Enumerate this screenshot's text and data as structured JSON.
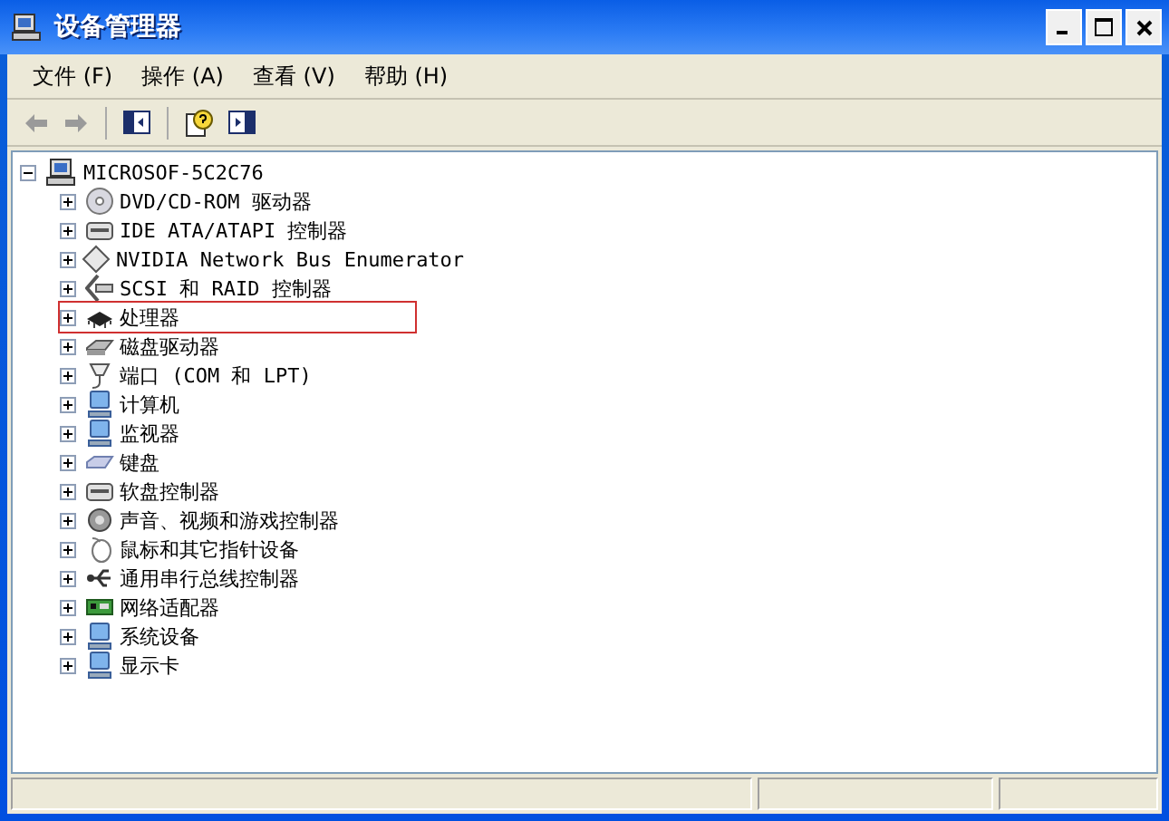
{
  "window": {
    "title": "设备管理器"
  },
  "menu": [
    {
      "label": "文件",
      "key": "(F)"
    },
    {
      "label": "操作",
      "key": "(A)"
    },
    {
      "label": "查看",
      "key": "(V)"
    },
    {
      "label": "帮助",
      "key": "(H)"
    }
  ],
  "toolbar": [
    {
      "kind": "back",
      "disabled": true
    },
    {
      "kind": "forward",
      "disabled": true
    },
    {
      "kind": "separator"
    },
    {
      "kind": "tree",
      "disabled": false
    },
    {
      "kind": "separator"
    },
    {
      "kind": "help",
      "disabled": false
    },
    {
      "kind": "pane",
      "disabled": false
    }
  ],
  "tree": {
    "label": "MICROSOF-5C2C76",
    "expanded": true,
    "children": [
      {
        "label": "DVD/CD-ROM 驱动器",
        "expanded": false,
        "highlighted": false
      },
      {
        "label": "IDE ATA/ATAPI 控制器",
        "expanded": false,
        "highlighted": false
      },
      {
        "label": "NVIDIA Network Bus Enumerator",
        "expanded": false,
        "highlighted": false
      },
      {
        "label": "SCSI 和 RAID 控制器",
        "expanded": false,
        "highlighted": false
      },
      {
        "label": "处理器",
        "expanded": false,
        "highlighted": true
      },
      {
        "label": "磁盘驱动器",
        "expanded": false,
        "highlighted": false
      },
      {
        "label": "端口 (COM 和 LPT)",
        "expanded": false,
        "highlighted": false
      },
      {
        "label": "计算机",
        "expanded": false,
        "highlighted": false
      },
      {
        "label": "监视器",
        "expanded": false,
        "highlighted": false
      },
      {
        "label": "键盘",
        "expanded": false,
        "highlighted": false
      },
      {
        "label": "软盘控制器",
        "expanded": false,
        "highlighted": false
      },
      {
        "label": "声音、视频和游戏控制器",
        "expanded": false,
        "highlighted": false
      },
      {
        "label": "鼠标和其它指针设备",
        "expanded": false,
        "highlighted": false
      },
      {
        "label": "通用串行总线控制器",
        "expanded": false,
        "highlighted": false
      },
      {
        "label": "网络适配器",
        "expanded": false,
        "highlighted": false
      },
      {
        "label": "系统设备",
        "expanded": false,
        "highlighted": false
      },
      {
        "label": "显示卡",
        "expanded": false,
        "highlighted": false
      }
    ]
  }
}
